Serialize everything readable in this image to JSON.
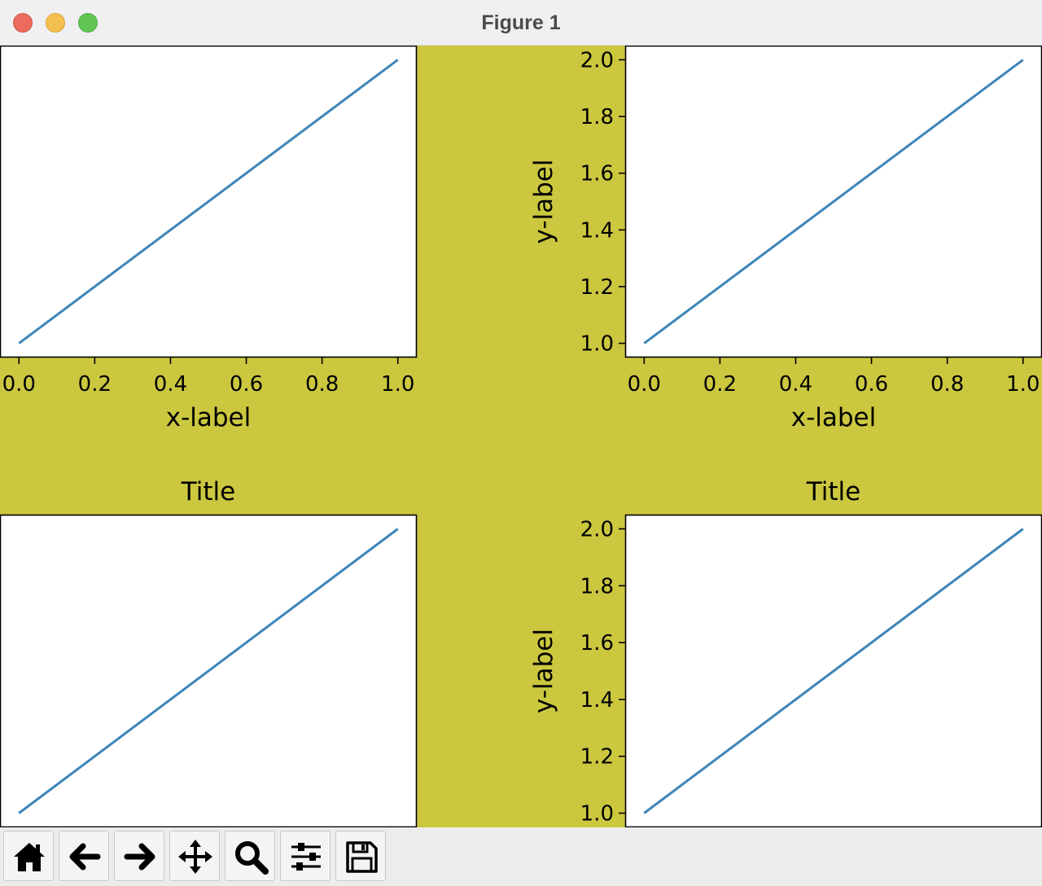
{
  "window": {
    "title": "Figure 1"
  },
  "figure": {
    "background_color": "#cbc73f",
    "line_color": "#3d85b8"
  },
  "chart_data": [
    {
      "type": "line",
      "title": "",
      "xlabel": "x-label",
      "ylabel": "",
      "x": [
        0,
        1
      ],
      "series": [
        {
          "values": [
            1,
            2
          ]
        }
      ],
      "xlim": [
        -0.05,
        1.05
      ],
      "ylim": [
        0.95,
        2.05
      ],
      "xticks": [
        0.0,
        0.2,
        0.4,
        0.6,
        0.8,
        1.0
      ],
      "xtick_labels": [
        "0.0",
        "0.2",
        "0.4",
        "0.6",
        "0.8",
        "1.0"
      ],
      "yticks": [],
      "ytick_labels": [],
      "grid": false
    },
    {
      "type": "line",
      "title": "",
      "xlabel": "x-label",
      "ylabel": "y-label",
      "x": [
        0,
        1
      ],
      "series": [
        {
          "values": [
            1,
            2
          ]
        }
      ],
      "xlim": [
        -0.05,
        1.05
      ],
      "ylim": [
        0.95,
        2.05
      ],
      "xticks": [
        0.0,
        0.2,
        0.4,
        0.6,
        0.8,
        1.0
      ],
      "xtick_labels": [
        "0.0",
        "0.2",
        "0.4",
        "0.6",
        "0.8",
        "1.0"
      ],
      "yticks": [
        1.0,
        1.2,
        1.4,
        1.6,
        1.8,
        2.0
      ],
      "ytick_labels": [
        "1.0",
        "1.2",
        "1.4",
        "1.6",
        "1.8",
        "2.0"
      ],
      "grid": false
    },
    {
      "type": "line",
      "title": "Title",
      "xlabel": "",
      "ylabel": "",
      "x": [
        0,
        1
      ],
      "series": [
        {
          "values": [
            1,
            2
          ]
        }
      ],
      "xlim": [
        -0.05,
        1.05
      ],
      "ylim": [
        0.95,
        2.05
      ],
      "xticks": [],
      "xtick_labels": [],
      "yticks": [],
      "ytick_labels": [],
      "grid": false
    },
    {
      "type": "line",
      "title": "Title",
      "xlabel": "",
      "ylabel": "y-label",
      "x": [
        0,
        1
      ],
      "series": [
        {
          "values": [
            1,
            2
          ]
        }
      ],
      "xlim": [
        -0.05,
        1.05
      ],
      "ylim": [
        0.95,
        2.05
      ],
      "xticks": [],
      "xtick_labels": [],
      "yticks": [
        1.0,
        1.2,
        1.4,
        1.6,
        1.8,
        2.0
      ],
      "ytick_labels": [
        "1.0",
        "1.2",
        "1.4",
        "1.6",
        "1.8",
        "2.0"
      ],
      "grid": false
    }
  ],
  "toolbar": {
    "tools": [
      {
        "icon": "home-icon"
      },
      {
        "icon": "back-arrow-icon"
      },
      {
        "icon": "forward-arrow-icon"
      },
      {
        "icon": "pan-icon"
      },
      {
        "icon": "zoom-icon"
      },
      {
        "icon": "configure-subplots-icon"
      },
      {
        "icon": "save-icon"
      }
    ]
  }
}
